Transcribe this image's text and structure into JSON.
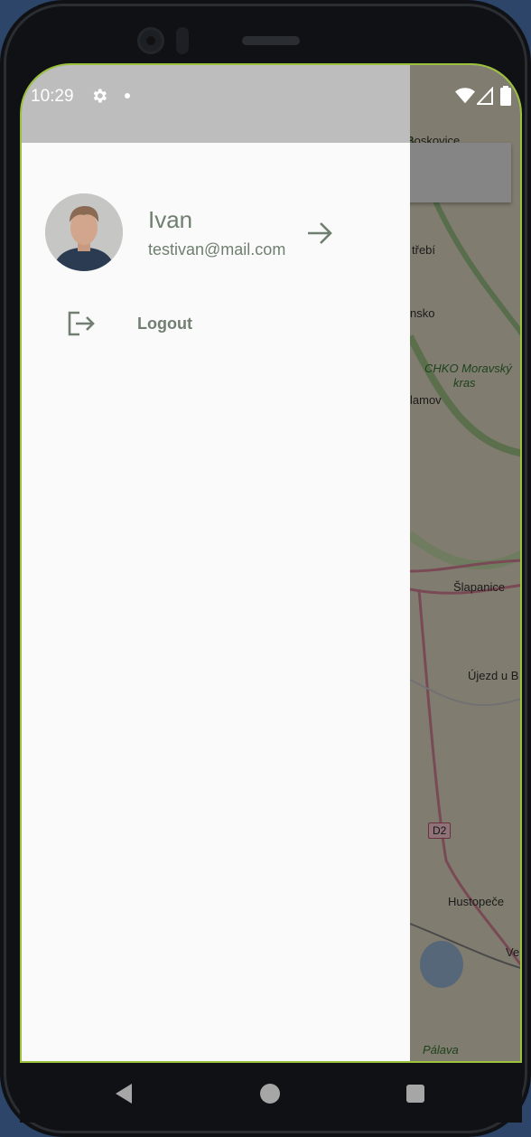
{
  "status_bar": {
    "time": "10:29",
    "icons": [
      "gear-icon",
      "dot-icon",
      "wifi-icon",
      "signal-icon",
      "battery-icon"
    ]
  },
  "drawer": {
    "user": {
      "name": "Ivan",
      "email": "testivan@mail.com",
      "avatar": "avatar-photo"
    },
    "items": [
      {
        "label": "Logout",
        "icon": "logout-icon"
      }
    ]
  },
  "map": {
    "labels": [
      "Boskovice",
      "třebí",
      "nsko",
      "CHKO Moravský",
      "kras",
      "lamov",
      "Šlapanice",
      "Újezd u B",
      "Hustopeče",
      "Ve",
      "Pálava"
    ],
    "road_badge": "D2",
    "search_close_icon": "close-icon"
  },
  "nav_bar": {
    "icons": [
      "back-icon",
      "home-icon",
      "recents-icon"
    ]
  },
  "colors": {
    "drawer_bg": "#fafafa",
    "accent_text": "#6f7f6f",
    "status_bar": "#bdbdbd",
    "screen_border": "#9bc03a"
  }
}
